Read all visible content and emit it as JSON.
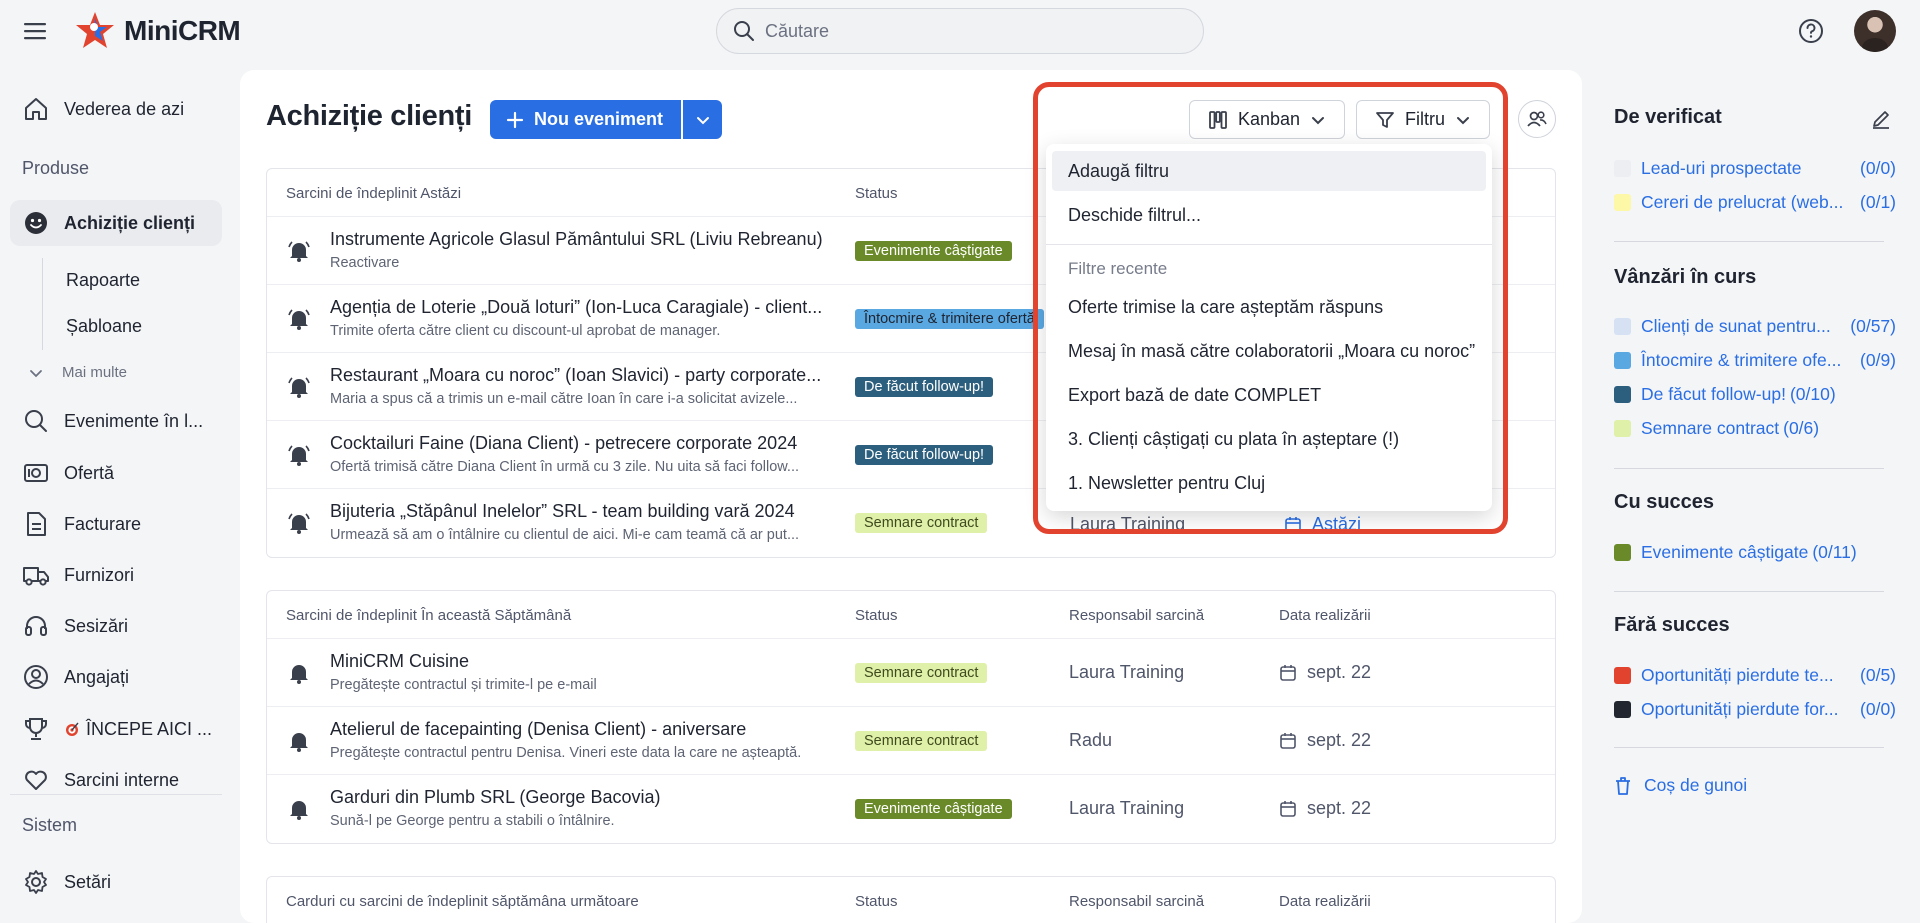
{
  "app": {
    "name": "MiniCRM"
  },
  "search": {
    "placeholder": "Căutare"
  },
  "sidebar": {
    "today": "Vederea de azi",
    "section_products": "Produse",
    "acquisition": "Achiziție clienți",
    "sub_reports": "Rapoarte",
    "sub_templates": "Șabloane",
    "more": "Mai multe",
    "events": "Evenimente în l...",
    "offer": "Ofertă",
    "billing": "Facturare",
    "suppliers": "Furnizori",
    "tickets": "Sesizări",
    "employees": "Angajați",
    "start": "ÎNCEPE AICI ...",
    "internal_tasks": "Sarcini interne",
    "section_system": "Sistem",
    "settings": "Setări"
  },
  "main": {
    "title": "Achiziție clienți",
    "new_event": "Nou eveniment",
    "view": "Kanban",
    "filter": "Filtru"
  },
  "tables": [
    {
      "headers": {
        "task": "Sarcini de îndeplinit Astăzi",
        "status": "Status",
        "resp": "",
        "date": ""
      },
      "rows": [
        {
          "title": "Instrumente Agricole Glasul Pământului SRL (Liviu Rebreanu)",
          "sub": "Reactivare",
          "status": "Evenimente câștigate",
          "status_kind": "green",
          "resp": "",
          "date": ""
        },
        {
          "title": "Agenția de Loterie „Două loturi” (Ion-Luca Caragiale) - client...",
          "sub": "Trimite oferta către client cu discount-ul aprobat de manager.",
          "status": "Întocmire & trimitere ofertă",
          "status_kind": "blue",
          "resp": "",
          "date": ""
        },
        {
          "title": "Restaurant „Moara cu noroc” (Ioan Slavici) - party corporate...",
          "sub": "Maria a spus că a trimis un e-mail către Ioan în care i-a solicitat avizele...",
          "status": "De făcut follow-up!",
          "status_kind": "navy",
          "resp": "",
          "date": ""
        },
        {
          "title": "Cocktailuri Faine (Diana Client) - petrecere corporate 2024",
          "sub": "Ofertă trimisă către Diana Client în urmă cu 3 zile. Nu uita să faci follow...",
          "status": "De făcut follow-up!",
          "status_kind": "navy",
          "resp": "",
          "date": ""
        },
        {
          "title": "Bijuteria „Stăpânul Inelelor” SRL - team building vară 2024",
          "sub": "Urmează să am o întâlnire cu clientul de aici. Mi-e cam teamă că ar put...",
          "status": "Semnare contract",
          "status_kind": "lime",
          "resp": "Laura Training",
          "date": "Astăzi"
        }
      ]
    },
    {
      "headers": {
        "task": "Sarcini de îndeplinit În această Săptămână",
        "status": "Status",
        "resp": "Responsabil sarcină",
        "date": "Data realizării"
      },
      "rows": [
        {
          "title": "MiniCRM Cuisine",
          "sub": "Pregătește contractul și trimite-l pe e-mail",
          "status": "Semnare contract",
          "status_kind": "lime",
          "resp": "Laura Training",
          "date": "sept. 22"
        },
        {
          "title": "Atelierul de facepainting (Denisa Client) - aniversare",
          "sub": "Pregătește contractul pentru Denisa. Vineri este data la care ne așteaptă.",
          "status": "Semnare contract",
          "status_kind": "lime",
          "resp": "Radu",
          "date": "sept. 22"
        },
        {
          "title": "Garduri din Plumb SRL (George Bacovia)",
          "sub": "Sună-l pe George pentru a stabili o întâlnire.",
          "status": "Evenimente câștigate",
          "status_kind": "green",
          "resp": "Laura Training",
          "date": "sept. 22"
        }
      ]
    },
    {
      "headers": {
        "task": "Carduri cu sarcini de îndeplinit săptămâna următoare",
        "status": "Status",
        "resp": "Responsabil sarcină",
        "date": "Data realizării"
      },
      "rows": []
    }
  ],
  "dropdown": {
    "add_filter": "Adaugă filtru",
    "open_filter": "Deschide filtrul...",
    "recent_title": "Filtre recente",
    "recent": [
      "Oferte trimise la care așteptăm răspuns",
      "Mesaj în masă către colaboratorii „Moara cu noroc”",
      "Export bază de date COMPLET",
      "3. Clienți câștigați cu plata în așteptare (!)",
      "1. Newsletter pentru Cluj"
    ]
  },
  "rpanel": {
    "to_check": "De verificat",
    "to_check_items": [
      {
        "label": "Lead-uri prospectate",
        "count": "(0/0)",
        "color": "#eceef2"
      },
      {
        "label": "Cereri de prelucrat (web...",
        "count": "(0/1)",
        "color": "#fdf7a8"
      }
    ],
    "in_progress": "Vânzări în curs",
    "in_progress_items": [
      {
        "label": "Clienți de sunat pentru...",
        "count": "(0/57)",
        "color": "#d6e2f3"
      },
      {
        "label": "Întocmire & trimitere ofe...",
        "count": "(0/9)",
        "color": "#5aa8e2"
      },
      {
        "label": "De făcut follow-up!",
        "count": "(0/10)",
        "color": "#2c5f7e"
      },
      {
        "label": "Semnare contract",
        "count": "(0/6)",
        "color": "#dff0a8"
      }
    ],
    "success": "Cu succes",
    "success_items": [
      {
        "label": "Evenimente câștigate",
        "count": "(0/11)",
        "color": "#6a8a2a"
      }
    ],
    "fail": "Fără succes",
    "fail_items": [
      {
        "label": "Oportunități pierdute te...",
        "count": "(0/5)",
        "color": "#e2432e"
      },
      {
        "label": "Oportunități pierdute for...",
        "count": "(0/0)",
        "color": "#22262f"
      }
    ],
    "trash": "Coș de gunoi"
  }
}
